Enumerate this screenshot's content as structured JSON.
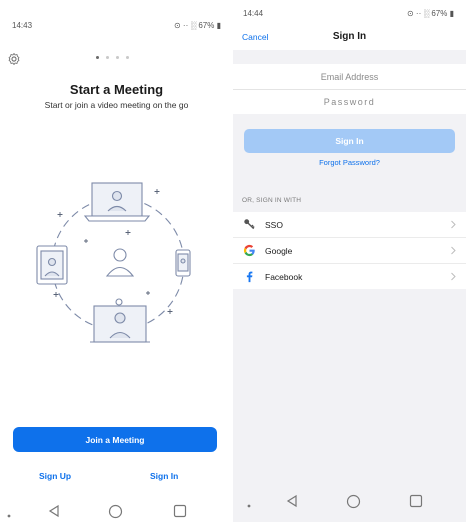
{
  "left": {
    "status": {
      "time": "14:43",
      "icons": "⊙ ·· ░ 67% ▮"
    },
    "title": "Start a Meeting",
    "subtitle": "Start or join a video meeting on the go",
    "pager": {
      "count": 4,
      "active": 1
    },
    "join_button": "Join a Meeting",
    "sign_up": "Sign Up",
    "sign_in": "Sign In"
  },
  "right": {
    "status": {
      "time": "14:44",
      "icons": "⊙ ·· ░ 67% ▮"
    },
    "nav": {
      "cancel": "Cancel",
      "title": "Sign In"
    },
    "email_placeholder": "Email Address",
    "password_placeholder": "Password",
    "sign_in_button": "Sign In",
    "forgot_password": "Forgot Password?",
    "or_sign_in_with": "OR, SIGN IN WITH",
    "providers": [
      {
        "label": "SSO",
        "icon": "key-icon"
      },
      {
        "label": "Google",
        "icon": "google-icon"
      },
      {
        "label": "Facebook",
        "icon": "facebook-icon"
      }
    ]
  },
  "colors": {
    "accent": "#0e71eb",
    "accent_disabled": "#a3c9f6",
    "google_blue": "#4285f4",
    "google_red": "#ea4335",
    "google_yellow": "#fbbc05",
    "google_green": "#34a853",
    "facebook_blue": "#1877f2"
  }
}
